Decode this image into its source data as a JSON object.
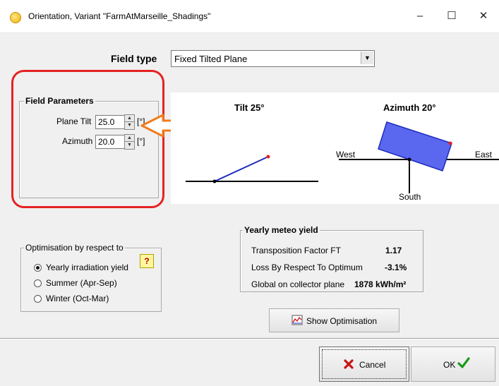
{
  "window": {
    "title": "Orientation, Variant \"FarmAtMarseille_Shadings\"",
    "controls": {
      "minimize": "–",
      "maximize": "☐",
      "close": "✕"
    }
  },
  "field_type": {
    "label": "Field type",
    "value": "Fixed Tilted Plane"
  },
  "field_parameters": {
    "title": "Field Parameters",
    "plane_tilt": {
      "label": "Plane Tilt",
      "value": "25.0",
      "unit": "[°]"
    },
    "azimuth": {
      "label": "Azimuth",
      "value": "20.0",
      "unit": "[°]"
    }
  },
  "diagrams": {
    "tilt_title": "Tilt 25°",
    "azimuth_title": "Azimuth 20°",
    "west": "West",
    "east": "East",
    "south": "South"
  },
  "optimisation": {
    "title": "Optimisation by respect to",
    "help": "?",
    "options": [
      {
        "label": "Yearly irradiation yield",
        "checked": true
      },
      {
        "label": "Summer (Apr-Sep)",
        "checked": false
      },
      {
        "label": "Winter (Oct-Mar)",
        "checked": false
      }
    ]
  },
  "meteo_yield": {
    "title": "Yearly meteo yield",
    "rows": [
      {
        "label": "Transposition Factor FT",
        "value": "1.17"
      },
      {
        "label": "Loss By Respect To Optimum",
        "value": "-3.1%"
      },
      {
        "label": "Global on collector plane",
        "value": "1878 kWh/m²"
      }
    ]
  },
  "buttons": {
    "show_optimisation": "Show Optimisation",
    "cancel": "Cancel",
    "ok": "OK"
  },
  "colors": {
    "highlight_red": "#e52222",
    "arrow_orange": "#f07c1e",
    "plane_blue": "#5a68f0",
    "tilt_line": "#1f2dbd"
  },
  "icons": {
    "app": "sun-icon",
    "cancel": "red-x-icon",
    "ok": "green-check-icon",
    "chart": "chart-icon",
    "dropdown": "chevron-down-icon"
  }
}
